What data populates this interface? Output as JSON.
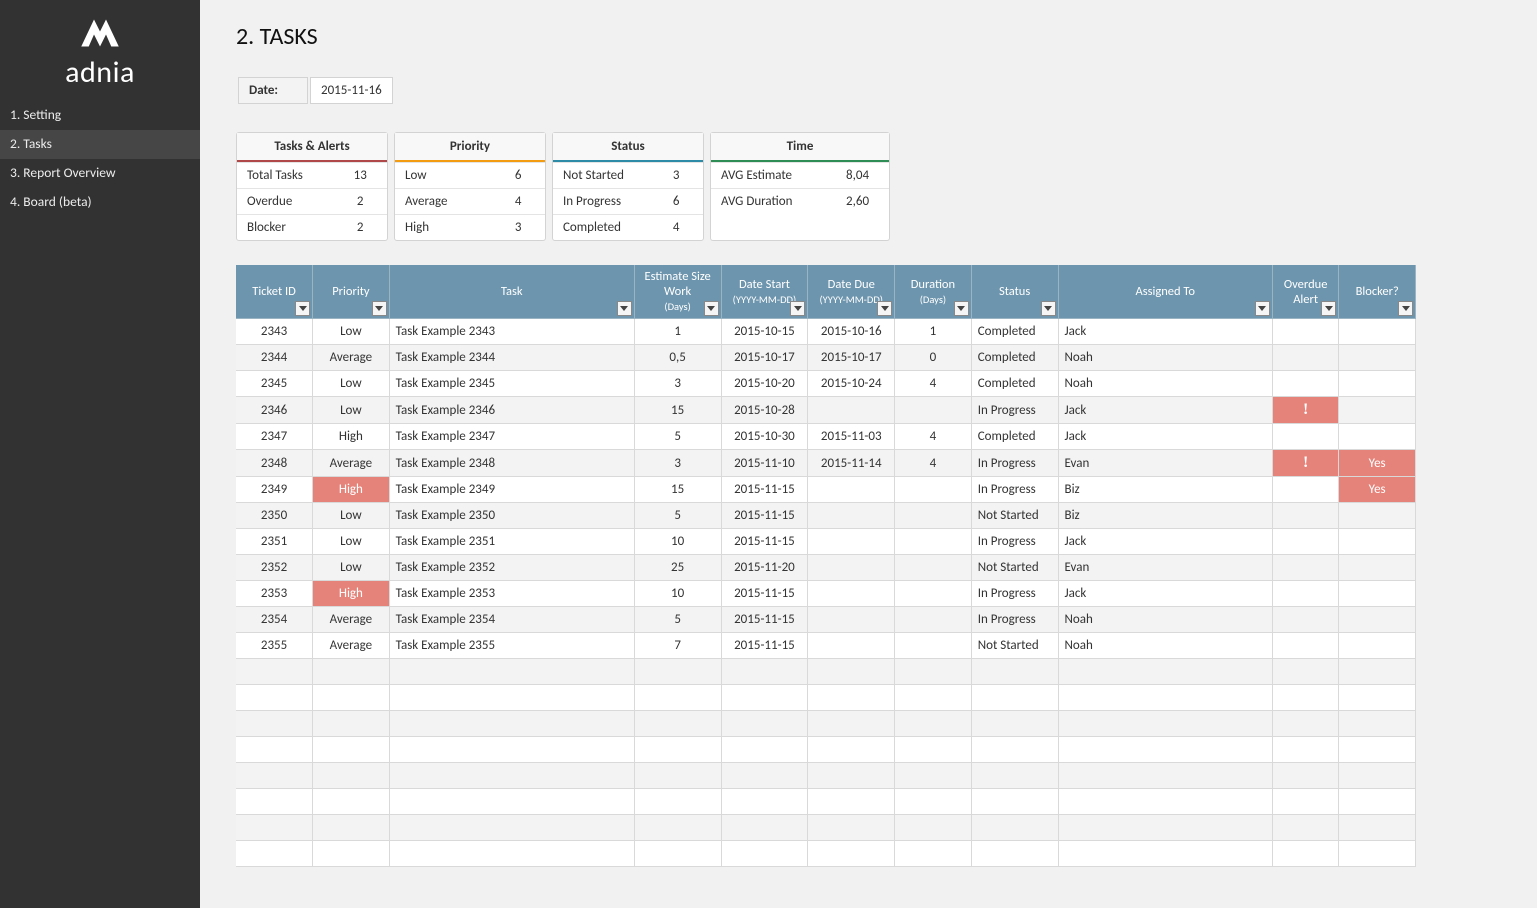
{
  "brand": "adnia",
  "nav": [
    {
      "label": "1. Setting",
      "active": false
    },
    {
      "label": "2. Tasks",
      "active": true
    },
    {
      "label": "3. Report Overview",
      "active": false
    },
    {
      "label": "4. Board (beta)",
      "active": false
    }
  ],
  "page_title": "2. TASKS",
  "date_label": "Date:",
  "date_value": "2015-11-16",
  "summary": {
    "alerts": {
      "title": "Tasks & Alerts",
      "rows": [
        {
          "k": "Total Tasks",
          "v": "13"
        },
        {
          "k": "Overdue",
          "v": "2"
        },
        {
          "k": "Blocker",
          "v": "2"
        }
      ]
    },
    "priority": {
      "title": "Priority",
      "rows": [
        {
          "k": "Low",
          "v": "6"
        },
        {
          "k": "Average",
          "v": "4"
        },
        {
          "k": "High",
          "v": "3"
        }
      ]
    },
    "status": {
      "title": "Status",
      "rows": [
        {
          "k": "Not Started",
          "v": "3"
        },
        {
          "k": "In Progress",
          "v": "6"
        },
        {
          "k": "Completed",
          "v": "4"
        }
      ]
    },
    "time": {
      "title": "Time",
      "rows": [
        {
          "k": "AVG Estimate",
          "v": "8,04"
        },
        {
          "k": "AVG Duration",
          "v": "2,60"
        }
      ]
    }
  },
  "columns": [
    {
      "key": "ticket",
      "label": "Ticket ID",
      "cls": "col-id"
    },
    {
      "key": "priority",
      "label": "Priority",
      "cls": "col-prio"
    },
    {
      "key": "task",
      "label": "Task",
      "cls": "col-task"
    },
    {
      "key": "est",
      "label": "Estimate Size Work (Days)",
      "cls": "col-est"
    },
    {
      "key": "ds",
      "label": "Date Start (YYYY-MM-DD)",
      "cls": "col-ds"
    },
    {
      "key": "dd",
      "label": "Date Due (YYYY-MM-DD)",
      "cls": "col-dd"
    },
    {
      "key": "dur",
      "label": "Duration (Days)",
      "cls": "col-dur"
    },
    {
      "key": "status",
      "label": "Status",
      "cls": "col-status"
    },
    {
      "key": "assn",
      "label": "Assigned To",
      "cls": "col-assn"
    },
    {
      "key": "over",
      "label": "Overdue Alert",
      "cls": "col-over"
    },
    {
      "key": "blk",
      "label": "Blocker?",
      "cls": "col-blk"
    }
  ],
  "rows": [
    {
      "ticket": "2343",
      "priority": "Low",
      "task": "Task Example 2343",
      "est": "1",
      "ds": "2015-10-15",
      "dd": "2015-10-16",
      "dur": "1",
      "status": "Completed",
      "assn": "Jack",
      "over": "",
      "blk": "",
      "prio_hot": false
    },
    {
      "ticket": "2344",
      "priority": "Average",
      "task": "Task Example 2344",
      "est": "0,5",
      "ds": "2015-10-17",
      "dd": "2015-10-17",
      "dur": "0",
      "status": "Completed",
      "assn": "Noah",
      "over": "",
      "blk": "",
      "prio_hot": false
    },
    {
      "ticket": "2345",
      "priority": "Low",
      "task": "Task Example 2345",
      "est": "3",
      "ds": "2015-10-20",
      "dd": "2015-10-24",
      "dur": "4",
      "status": "Completed",
      "assn": "Noah",
      "over": "",
      "blk": "",
      "prio_hot": false
    },
    {
      "ticket": "2346",
      "priority": "Low",
      "task": "Task Example 2346",
      "est": "15",
      "ds": "2015-10-28",
      "dd": "",
      "dur": "",
      "status": "In Progress",
      "assn": "Jack",
      "over": "!",
      "blk": "",
      "prio_hot": false
    },
    {
      "ticket": "2347",
      "priority": "High",
      "task": "Task Example 2347",
      "est": "5",
      "ds": "2015-10-30",
      "dd": "2015-11-03",
      "dur": "4",
      "status": "Completed",
      "assn": "Jack",
      "over": "",
      "blk": "",
      "prio_hot": false
    },
    {
      "ticket": "2348",
      "priority": "Average",
      "task": "Task Example 2348",
      "est": "3",
      "ds": "2015-11-10",
      "dd": "2015-11-14",
      "dur": "4",
      "status": "In Progress",
      "assn": "Evan",
      "over": "!",
      "blk": "Yes",
      "prio_hot": false
    },
    {
      "ticket": "2349",
      "priority": "High",
      "task": "Task Example 2349",
      "est": "15",
      "ds": "2015-11-15",
      "dd": "",
      "dur": "",
      "status": "In Progress",
      "assn": "Biz",
      "over": "",
      "blk": "Yes",
      "prio_hot": true
    },
    {
      "ticket": "2350",
      "priority": "Low",
      "task": "Task Example 2350",
      "est": "5",
      "ds": "2015-11-15",
      "dd": "",
      "dur": "",
      "status": "Not Started",
      "assn": "Biz",
      "over": "",
      "blk": "",
      "prio_hot": false
    },
    {
      "ticket": "2351",
      "priority": "Low",
      "task": "Task Example 2351",
      "est": "10",
      "ds": "2015-11-15",
      "dd": "",
      "dur": "",
      "status": "In Progress",
      "assn": "Jack",
      "over": "",
      "blk": "",
      "prio_hot": false
    },
    {
      "ticket": "2352",
      "priority": "Low",
      "task": "Task Example 2352",
      "est": "25",
      "ds": "2015-11-20",
      "dd": "",
      "dur": "",
      "status": "Not Started",
      "assn": "Evan",
      "over": "",
      "blk": "",
      "prio_hot": false
    },
    {
      "ticket": "2353",
      "priority": "High",
      "task": "Task Example 2353",
      "est": "10",
      "ds": "2015-11-15",
      "dd": "",
      "dur": "",
      "status": "In Progress",
      "assn": "Jack",
      "over": "",
      "blk": "",
      "prio_hot": true
    },
    {
      "ticket": "2354",
      "priority": "Average",
      "task": "Task Example 2354",
      "est": "5",
      "ds": "2015-11-15",
      "dd": "",
      "dur": "",
      "status": "In Progress",
      "assn": "Noah",
      "over": "",
      "blk": "",
      "prio_hot": false
    },
    {
      "ticket": "2355",
      "priority": "Average",
      "task": "Task Example 2355",
      "est": "7",
      "ds": "2015-11-15",
      "dd": "",
      "dur": "",
      "status": "Not Started",
      "assn": "Noah",
      "over": "",
      "blk": "",
      "prio_hot": false
    }
  ],
  "empty_rows": 8
}
